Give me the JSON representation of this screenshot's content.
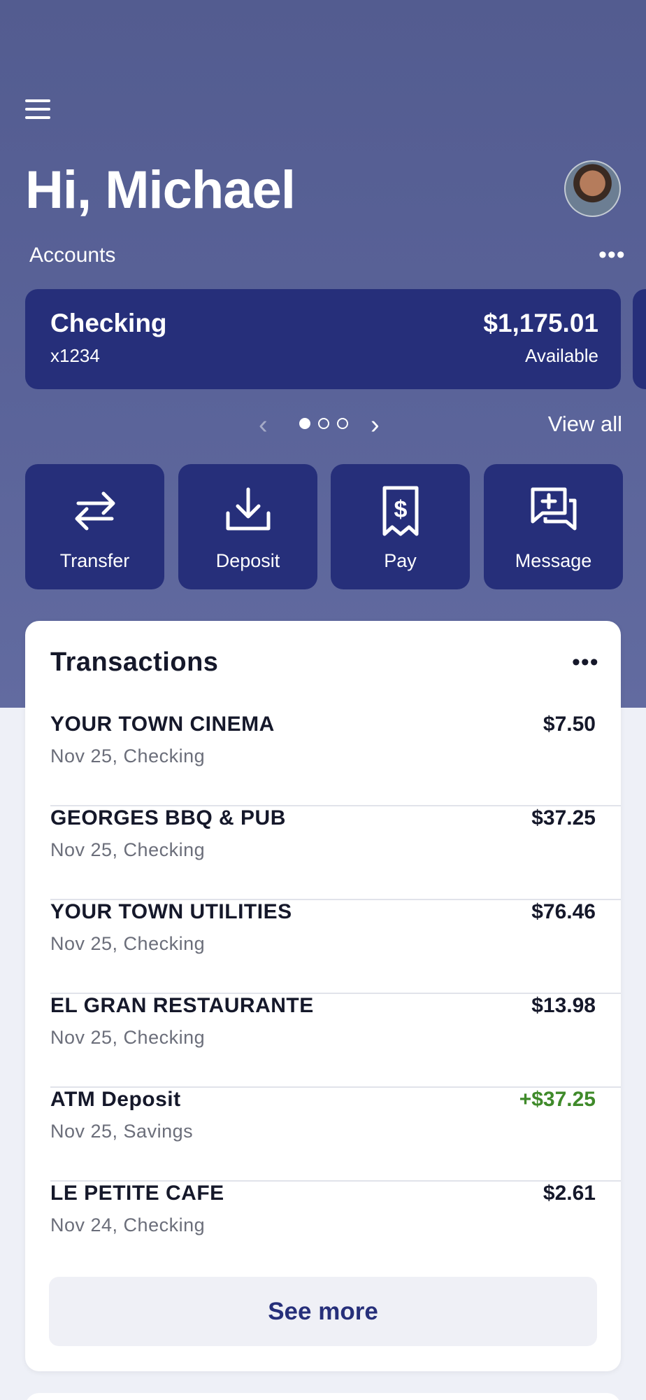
{
  "header": {
    "greeting": "Hi, Michael"
  },
  "accounts": {
    "label": "Accounts",
    "more_icon": "more-horizontal-icon",
    "card": {
      "name": "Checking",
      "number": "x1234",
      "balance": "$1,175.01",
      "balance_label": "Available"
    },
    "pager": {
      "total": 3,
      "active_index": 0
    },
    "view_all": "View all"
  },
  "actions": [
    {
      "label": "Transfer",
      "icon": "transfer-icon"
    },
    {
      "label": "Deposit",
      "icon": "deposit-icon"
    },
    {
      "label": "Pay",
      "icon": "pay-bill-icon"
    },
    {
      "label": "Message",
      "icon": "message-icon"
    }
  ],
  "transactions": {
    "title": "Transactions",
    "items": [
      {
        "merchant": "YOUR TOWN CINEMA",
        "meta": "Nov 25, Checking",
        "amount": "$7.50",
        "credit": false
      },
      {
        "merchant": "GEORGES BBQ & PUB",
        "meta": "Nov 25, Checking",
        "amount": "$37.25",
        "credit": false
      },
      {
        "merchant": "YOUR TOWN UTILITIES",
        "meta": "Nov 25, Checking",
        "amount": "$76.46",
        "credit": false
      },
      {
        "merchant": "EL GRAN RESTAURANTE",
        "meta": "Nov 25, Checking",
        "amount": "$13.98",
        "credit": false
      },
      {
        "merchant": "ATM Deposit",
        "meta": "Nov 25, Savings",
        "amount": "+$37.25",
        "credit": true
      },
      {
        "merchant": "LE PETITE CAFE",
        "meta": "Nov 24, Checking",
        "amount": "$2.61",
        "credit": false
      }
    ],
    "see_more": "See more"
  },
  "colors": {
    "hero_bg": "#535c90",
    "card_bg": "#262f7a",
    "credit": "#3f8a2a",
    "page_bg": "#eef0f7"
  }
}
